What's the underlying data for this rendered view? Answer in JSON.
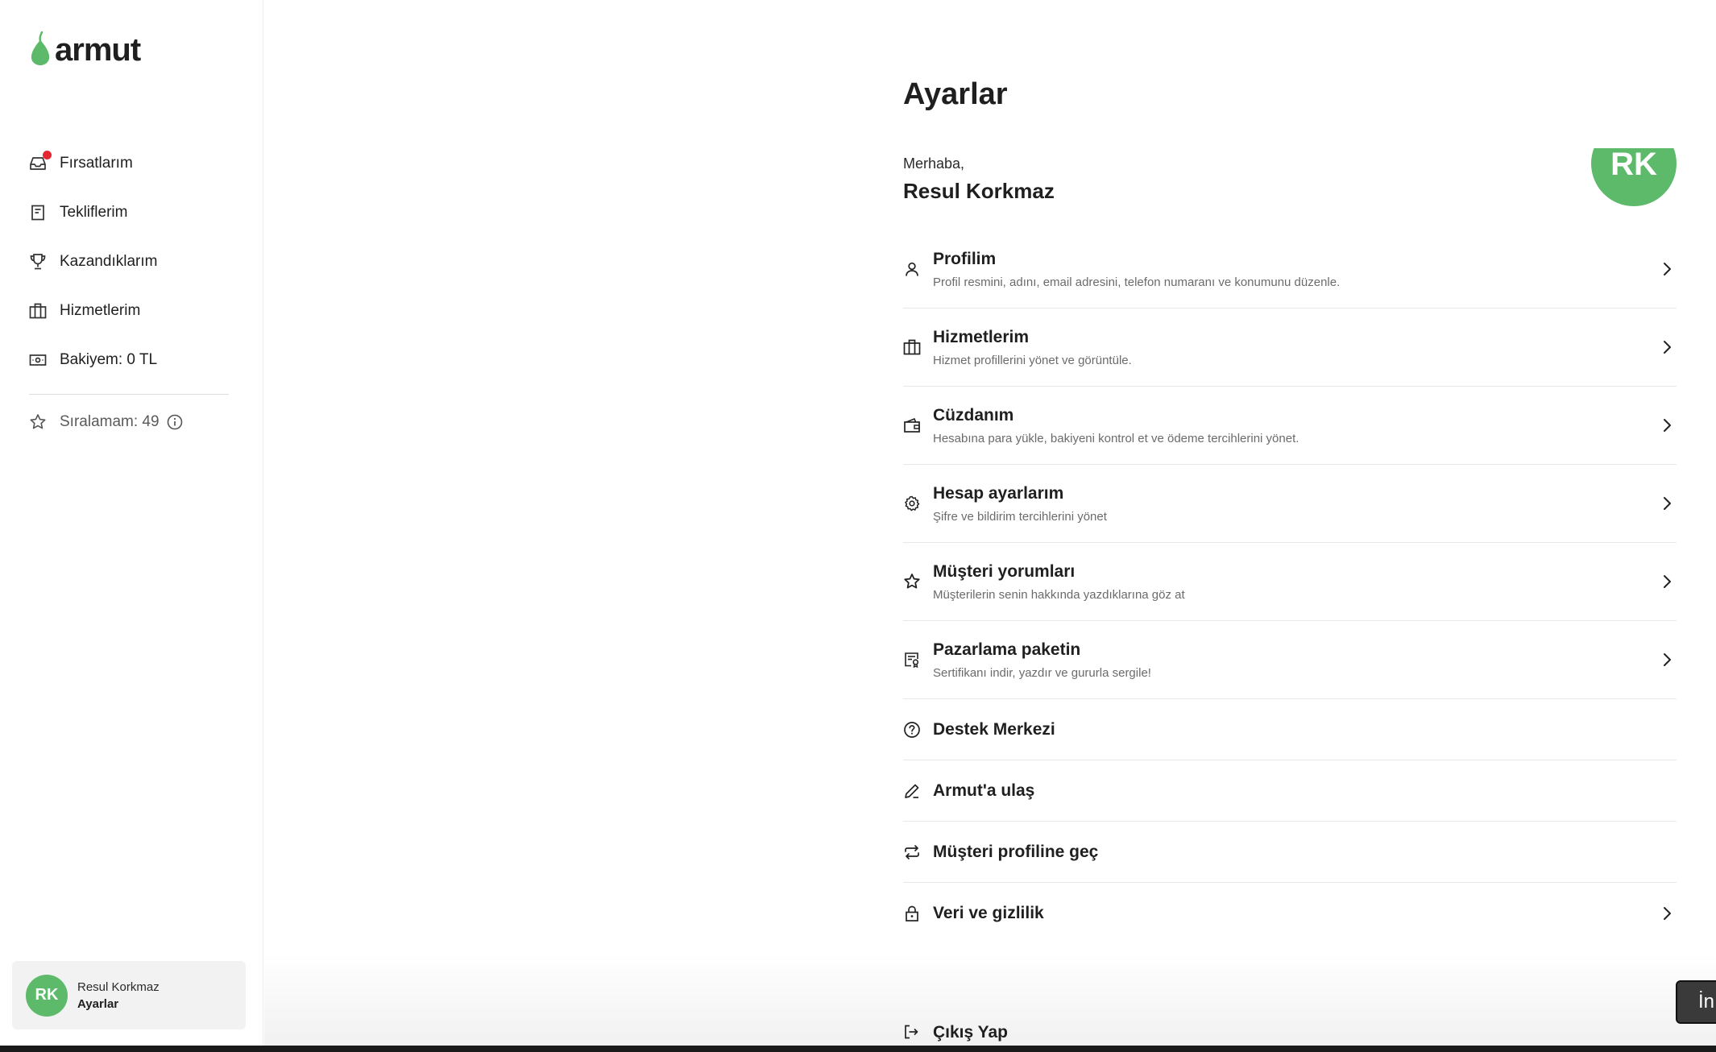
{
  "brand": {
    "name": "armut",
    "color": "#5cba6a"
  },
  "sidebar": {
    "items": [
      {
        "label": "Fırsatlarım",
        "icon": "inbox-icon",
        "has_notification": true
      },
      {
        "label": "Tekliflerim",
        "icon": "document-icon"
      },
      {
        "label": "Kazandıklarım",
        "icon": "trophy-icon"
      },
      {
        "label": "Hizmetlerim",
        "icon": "briefcase-icon"
      },
      {
        "label": "Bakiyem: 0 TL",
        "icon": "money-icon"
      }
    ],
    "rank": {
      "label": "Sıralamam: 49",
      "icon": "star-icon"
    },
    "user": {
      "initials": "RK",
      "name": "Resul Korkmaz",
      "subtitle": "Ayarlar"
    }
  },
  "main": {
    "title": "Ayarlar",
    "greeting": "Merhaba,",
    "user_name": "Resul Korkmaz",
    "avatar_initials": "RK",
    "menu": [
      {
        "title": "Profilim",
        "description": "Profil resmini, adını, email adresini, telefon numaranı ve konumunu düzenle.",
        "icon": "user-icon"
      },
      {
        "title": "Hizmetlerim",
        "description": "Hizmet profillerini yönet ve görüntüle.",
        "icon": "briefcase-icon"
      },
      {
        "title": "Cüzdanım",
        "description": "Hesabına para yükle, bakiyeni kontrol et ve ödeme tercihlerini yönet.",
        "icon": "wallet-icon"
      },
      {
        "title": "Hesap ayarlarım",
        "description": "Şifre ve bildirim tercihlerini yönet",
        "icon": "gear-icon"
      },
      {
        "title": "Müşteri yorumları",
        "description": "Müşterilerin senin hakkında yazdıklarına göz at",
        "icon": "star-icon"
      },
      {
        "title": "Pazarlama paketin",
        "description": "Sertifikanı indir, yazdır ve gururla sergile!",
        "icon": "certificate-icon"
      },
      {
        "title": "Destek Merkezi",
        "icon": "help-circle-icon"
      },
      {
        "title": "Armut'a ulaş",
        "icon": "pencil-icon"
      },
      {
        "title": "Müşteri profiline geç",
        "icon": "switch-icon"
      },
      {
        "title": "Veri ve gizlilik",
        "icon": "lock-icon"
      }
    ],
    "logout": {
      "title": "Çıkış Yap",
      "icon": "logout-icon"
    }
  },
  "floating_button": {
    "label": "İn"
  }
}
